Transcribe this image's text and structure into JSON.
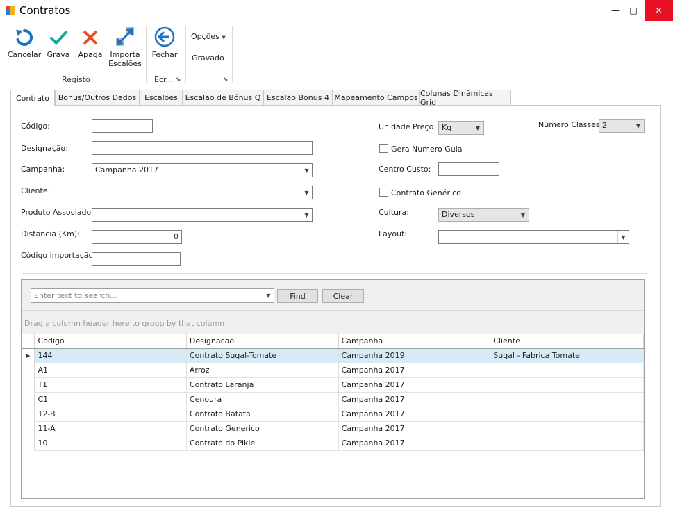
{
  "window": {
    "title": "Contratos",
    "minimize": "—",
    "maximize": "□",
    "close": "✕"
  },
  "ribbon": {
    "cancel": "Cancelar",
    "save": "Grava",
    "delete": "Apaga",
    "import": "Importa Escalões",
    "close": "Fechar",
    "options": "Opções",
    "status": "Gravado",
    "group_registo": "Registo",
    "group_ecra": "Ecr...",
    "colors": {
      "blue": "#1e73be",
      "green": "#1ba59c",
      "red": "#e8502a"
    }
  },
  "tabs": [
    "Contrato",
    "Bonus/Outros Dados",
    "Escalões",
    "Escalão de Bónus Q",
    "Escalão Bonus 4",
    "Mapeamento Campos",
    "Colunas Dinâmicas Grid"
  ],
  "form": {
    "codigo_label": "Código:",
    "codigo_value": "",
    "designacao_label": "Designação:",
    "designacao_value": "",
    "campanha_label": "Campanha:",
    "campanha_value": "Campanha 2017",
    "cliente_label": "Cliente:",
    "cliente_value": "",
    "produto_label": "Produto Associado:",
    "produto_value": "",
    "distancia_label": "Distancia (Km):",
    "distancia_value": "0",
    "codimport_label": "Código importação:",
    "codimport_value": "",
    "unidade_label": "Unidade Preço:",
    "unidade_value": "Kg",
    "numclasses_label": "Número Classes:",
    "numclasses_value": "2",
    "gera_label": "Gera Numero Guia",
    "gera_checked": false,
    "centro_label": "Centro Custo:",
    "centro_value": "",
    "generico_label": "Contrato Genérico",
    "generico_checked": false,
    "cultura_label": "Cultura:",
    "cultura_value": "Diversos",
    "layout_label": "Layout:",
    "layout_value": ""
  },
  "grid": {
    "search_placeholder": "Enter text to search...",
    "find": "Find",
    "clear": "Clear",
    "group_hint": "Drag a column header here to group by that column",
    "columns": [
      "Codigo",
      "Designacao",
      "Campanha",
      "Cliente"
    ],
    "rows": [
      [
        "144",
        "Contrato Sugal-Tomate",
        "Campanha 2019",
        "Sugal - Fabrica Tomate"
      ],
      [
        "A1",
        "Arroz",
        "Campanha 2017",
        ""
      ],
      [
        "T1",
        "Contrato Laranja",
        "Campanha 2017",
        ""
      ],
      [
        "C1",
        "Cenoura",
        "Campanha 2017",
        ""
      ],
      [
        "12-B",
        "Contrato Batata",
        "Campanha 2017",
        ""
      ],
      [
        "11-A",
        "Contrato Generico",
        "Campanha 2017",
        ""
      ],
      [
        "10",
        "Contrato do Pikle",
        "Campanha 2017",
        ""
      ]
    ],
    "selected_row": 0
  }
}
